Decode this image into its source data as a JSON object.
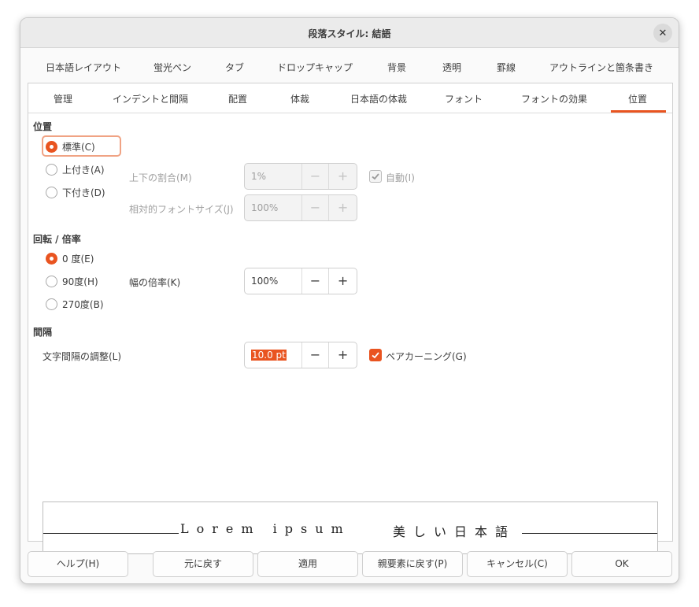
{
  "window": {
    "title": "段落スタイル: 結語"
  },
  "tabs_row1": [
    "日本語レイアウト",
    "蛍光ペン",
    "タブ",
    "ドロップキャップ",
    "背景",
    "透明",
    "罫線",
    "アウトラインと箇条書き"
  ],
  "tabs_row2": [
    "管理",
    "インデントと間隔",
    "配置",
    "体裁",
    "日本語の体裁",
    "フォント",
    "フォントの効果",
    "位置"
  ],
  "active_tab": "位置",
  "position": {
    "heading": "位置",
    "options": [
      "標準(C)",
      "上付き(A)",
      "下付き(D)"
    ],
    "selected": "標準(C)",
    "raise_lower_label": "上下の割合(M)",
    "raise_lower_value": "1%",
    "relative_size_label": "相対的フォントサイズ(J)",
    "relative_size_value": "100%",
    "automatic_label": "自動(I)",
    "automatic_checked": true
  },
  "rotation": {
    "heading": "回転 / 倍率",
    "options": [
      "0 度(E)",
      "90度(H)",
      "270度(B)"
    ],
    "selected": "0 度(E)",
    "scale_width_label": "幅の倍率(K)",
    "scale_width_value": "100%"
  },
  "spacing": {
    "heading": "間隔",
    "character_spacing_label": "文字間隔の調整(L)",
    "character_spacing_value": "10.0 pt",
    "pair_kerning_label": "ペアカーニング(G)",
    "pair_kerning_checked": true
  },
  "preview": {
    "left_text": "Lorem ipsum",
    "right_text": "美しい日本語"
  },
  "spin": {
    "minus": "−",
    "plus": "+"
  },
  "footer": {
    "help": "ヘルプ(H)",
    "reset": "元に戻す",
    "apply": "適用",
    "standard": "親要素に戻す(P)",
    "cancel": "キャンセル(C)",
    "ok": "OK"
  },
  "colors": {
    "accent": "#e95420"
  }
}
